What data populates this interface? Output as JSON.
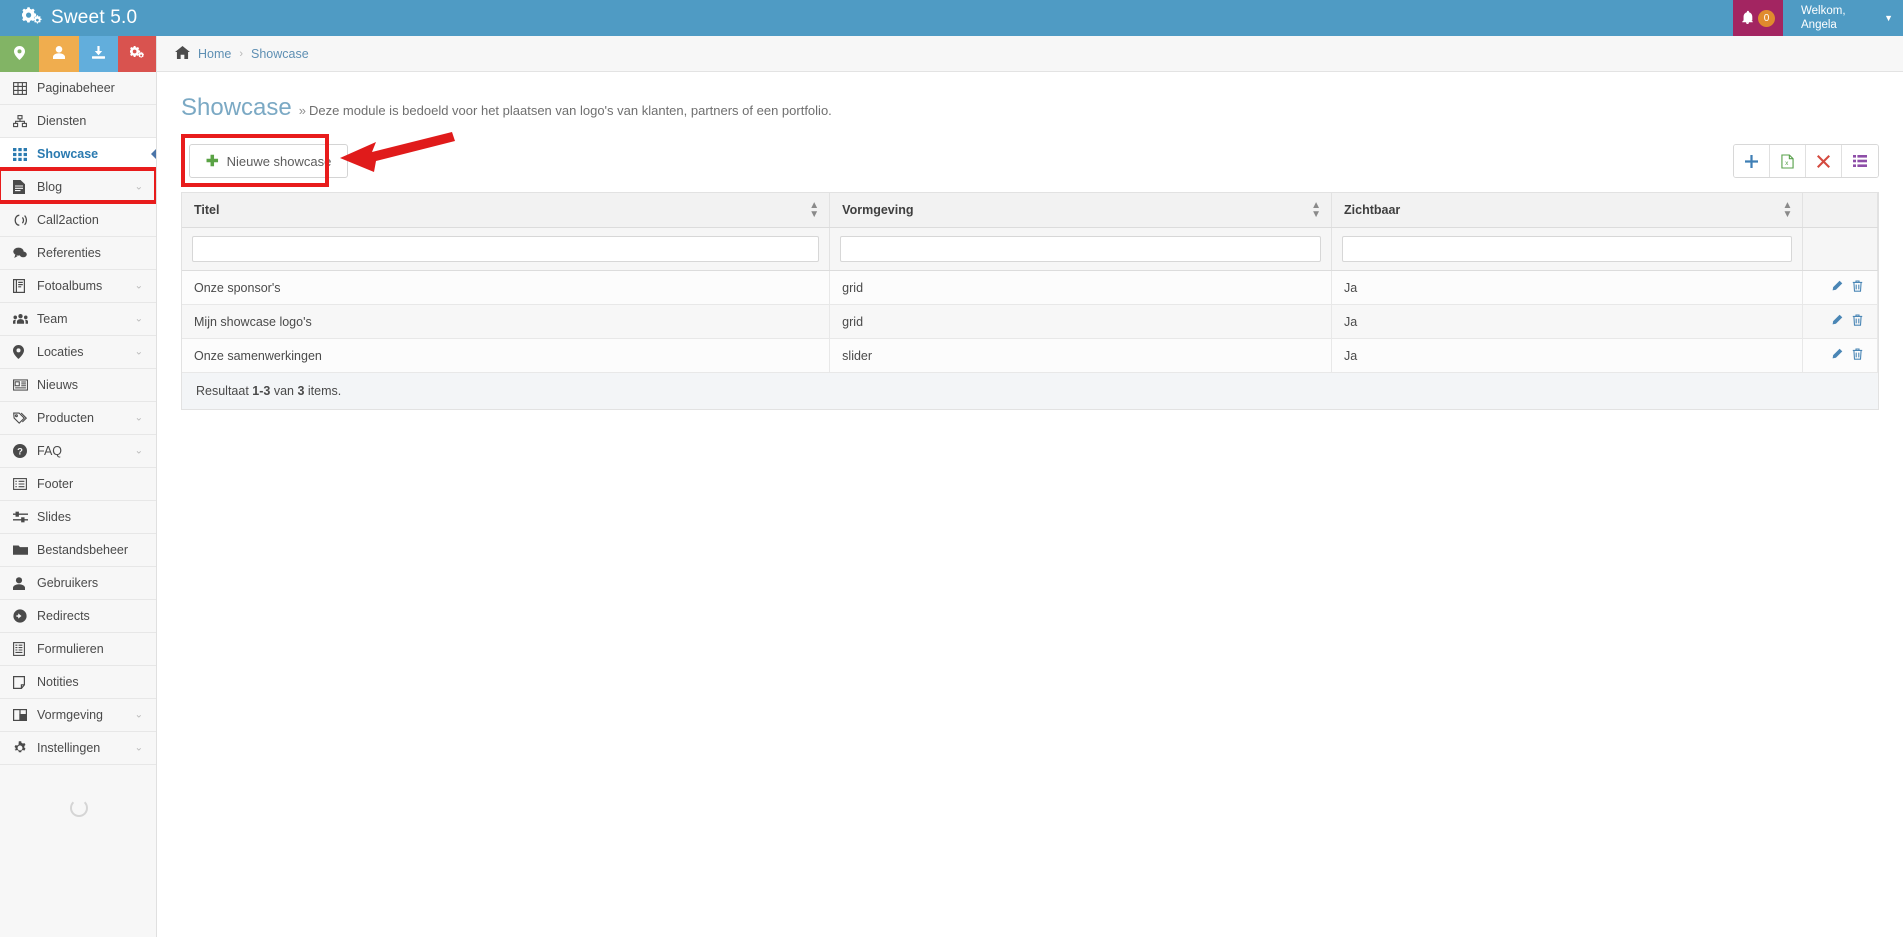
{
  "topbar": {
    "brand": "Sweet 5.0",
    "brand_icon": "gears-icon",
    "notifications": {
      "icon": "bell-icon",
      "count": "0"
    },
    "user": {
      "greeting": "Welkom,",
      "name": "Angela",
      "caret": "▼"
    }
  },
  "sidebar": {
    "quick_buttons": [
      {
        "name": "location-quick-button",
        "icon": "map-pin-icon",
        "color": "#82b465"
      },
      {
        "name": "user-quick-button",
        "icon": "user-icon",
        "color": "#f0ad4e"
      },
      {
        "name": "download-quick-button",
        "icon": "download-icon",
        "color": "#62aedc"
      },
      {
        "name": "settings-quick-button",
        "icon": "gears-icon",
        "color": "#d9534f"
      }
    ],
    "items": [
      {
        "label": "Paginabeheer",
        "icon": "table-icon",
        "chevron": "",
        "active": false
      },
      {
        "label": "Diensten",
        "icon": "sitemap-icon",
        "chevron": "",
        "active": false
      },
      {
        "label": "Showcase",
        "icon": "grid-icon",
        "chevron": "",
        "active": true
      },
      {
        "label": "Blog",
        "icon": "file-text-icon",
        "chevron": "⌄",
        "active": false
      },
      {
        "label": "Call2action",
        "icon": "phone-icon",
        "chevron": "",
        "active": false
      },
      {
        "label": "Referenties",
        "icon": "comments-icon",
        "chevron": "",
        "active": false
      },
      {
        "label": "Fotoalbums",
        "icon": "book-icon",
        "chevron": "⌄",
        "active": false
      },
      {
        "label": "Team",
        "icon": "users-icon",
        "chevron": "⌄",
        "active": false
      },
      {
        "label": "Locaties",
        "icon": "map-pin-icon",
        "chevron": "⌄",
        "active": false
      },
      {
        "label": "Nieuws",
        "icon": "newspaper-icon",
        "chevron": "",
        "active": false
      },
      {
        "label": "Producten",
        "icon": "tags-icon",
        "chevron": "⌄",
        "active": false
      },
      {
        "label": "FAQ",
        "icon": "question-icon",
        "chevron": "⌄",
        "active": false
      },
      {
        "label": "Footer",
        "icon": "list-alt-icon",
        "chevron": "",
        "active": false
      },
      {
        "label": "Slides",
        "icon": "sliders-icon",
        "chevron": "",
        "active": false
      },
      {
        "label": "Bestandsbeheer",
        "icon": "folder-open-icon",
        "chevron": "",
        "active": false
      },
      {
        "label": "Gebruikers",
        "icon": "user-icon",
        "chevron": "",
        "active": false
      },
      {
        "label": "Redirects",
        "icon": "arrow-circle-right-icon",
        "chevron": "",
        "active": false
      },
      {
        "label": "Formulieren",
        "icon": "form-icon",
        "chevron": "",
        "active": false
      },
      {
        "label": "Notities",
        "icon": "note-icon",
        "chevron": "",
        "active": false
      },
      {
        "label": "Vormgeving",
        "icon": "columns-icon",
        "chevron": "⌄",
        "active": false
      },
      {
        "label": "Instellingen",
        "icon": "gear-icon",
        "chevron": "⌄",
        "active": false
      }
    ]
  },
  "breadcrumb": {
    "home_icon": "home-icon",
    "home": "Home",
    "separator": "›",
    "current": "Showcase"
  },
  "page": {
    "title": "Showcase",
    "subtitle_marker": "»",
    "subtitle": "Deze module is bedoeld voor het plaatsen van logo's van klanten, partners of een portfolio."
  },
  "toolbar": {
    "new_button": {
      "label": "Nieuwe showcase",
      "icon": "plus-icon"
    },
    "buttons": [
      {
        "name": "add-row-button",
        "icon": "plus-icon",
        "glyph": "✚",
        "color": "#3f7fb5"
      },
      {
        "name": "export-excel-button",
        "icon": "excel-file-icon",
        "glyph": "🗒",
        "color": "#57a04a"
      },
      {
        "name": "delete-button",
        "icon": "close-x-icon",
        "glyph": "✖",
        "color": "#d44a3f"
      },
      {
        "name": "column-chooser-button",
        "icon": "list-columns-icon",
        "glyph": "☰",
        "color": "#8e4ea8"
      }
    ]
  },
  "table": {
    "columns": [
      "Titel",
      "Vormgeving",
      "Zichtbaar",
      ""
    ],
    "sort_icon": "sort-updown-icon",
    "filters": [
      "",
      "",
      ""
    ],
    "filter_placeholder": "",
    "rows": [
      {
        "titel": "Onze sponsor's",
        "vormgeving": "grid",
        "zichtbaar": "Ja"
      },
      {
        "titel": "Mijn showcase logo's",
        "vormgeving": "grid",
        "zichtbaar": "Ja"
      },
      {
        "titel": "Onze samenwerkingen",
        "vormgeving": "slider",
        "zichtbaar": "Ja"
      }
    ],
    "row_actions": [
      {
        "name": "edit-row-icon",
        "icon": "pencil-icon",
        "glyph": "✎"
      },
      {
        "name": "delete-row-icon",
        "icon": "trash-icon",
        "glyph": "🗑"
      }
    ]
  },
  "result": {
    "prefix": "Resultaat ",
    "range": "1-3",
    "middle": " van ",
    "total": "3",
    "suffix": " items."
  },
  "annotations": {
    "nav_highlight_color": "#e81c1c",
    "button_highlight_color": "#e81c1c",
    "arrow_color": "#e01b1b"
  }
}
